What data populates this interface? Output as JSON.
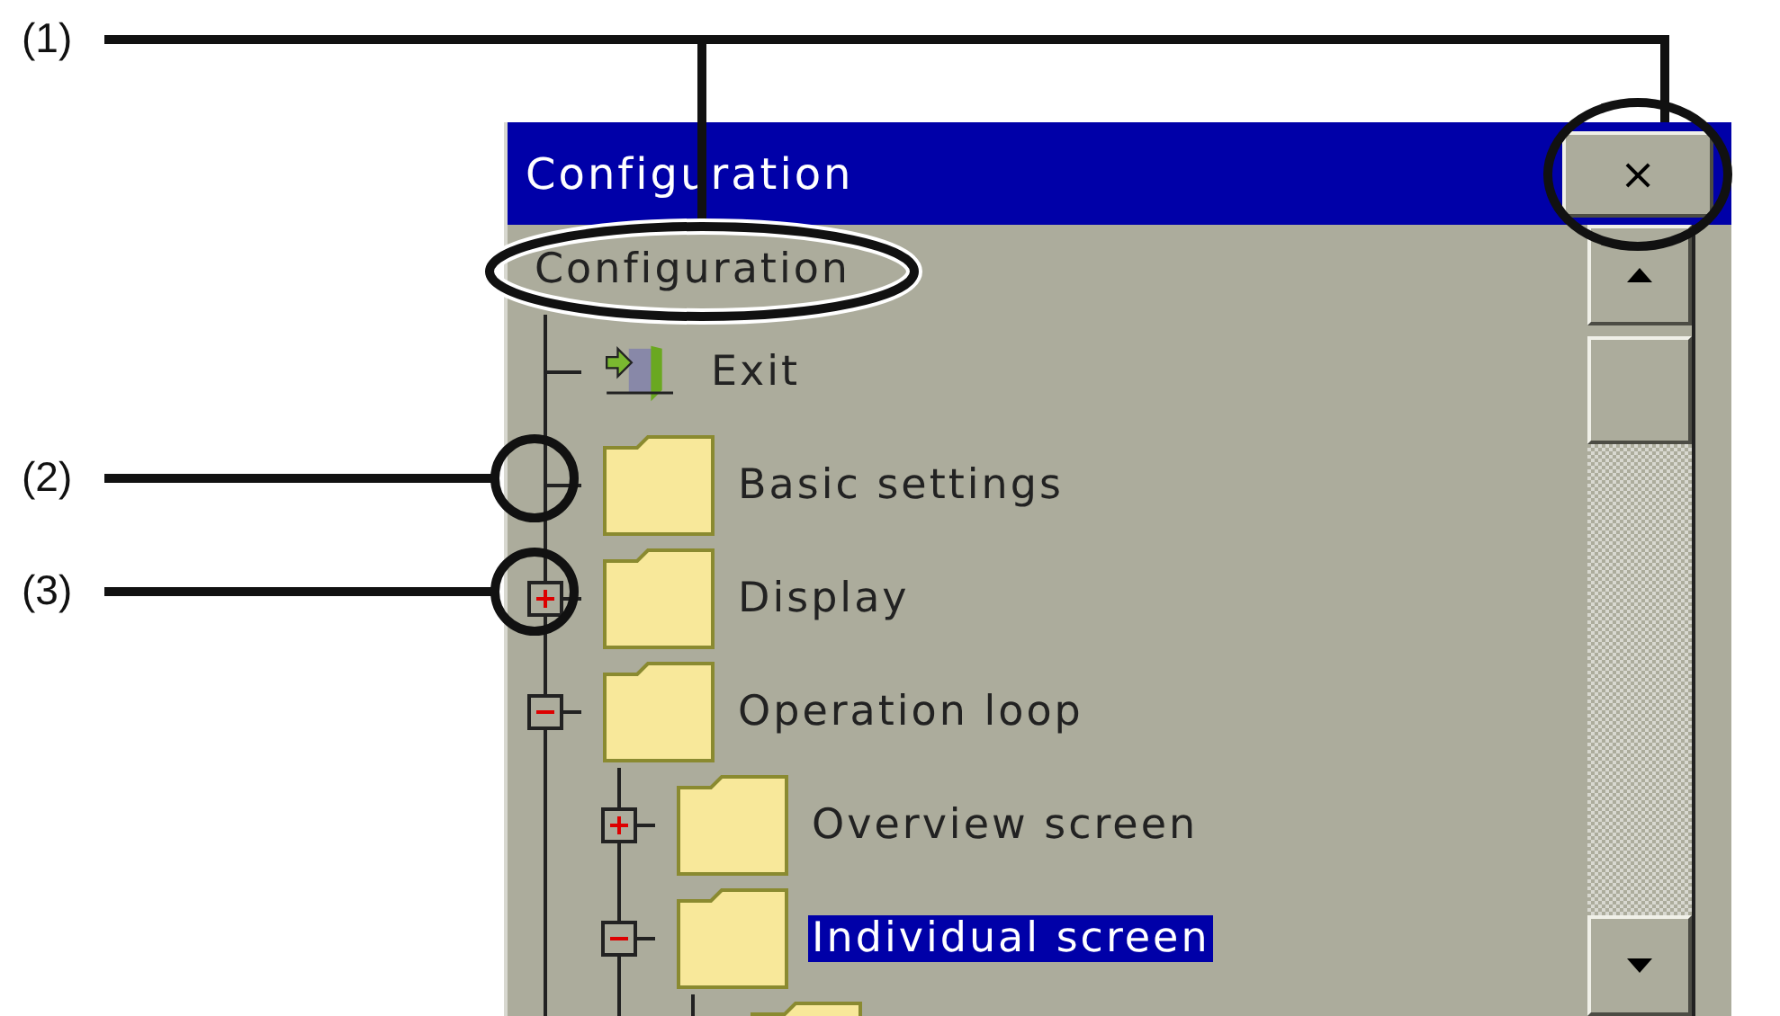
{
  "window": {
    "title": "Configuration",
    "close_label": "×"
  },
  "tree": {
    "root": "Configuration",
    "items": [
      {
        "kind": "exit",
        "label": "Exit"
      },
      {
        "kind": "folder",
        "label": "Basic settings"
      },
      {
        "kind": "folder",
        "label": "Display",
        "expanded": false
      },
      {
        "kind": "folder",
        "label": "Operation loop",
        "expanded": true,
        "children": [
          {
            "kind": "folder",
            "label": "Overview screen",
            "expanded": false,
            "selected": false
          },
          {
            "kind": "folder",
            "label": "Individual screen",
            "expanded": true,
            "selected": true,
            "children": [
              {
                "kind": "folder"
              }
            ]
          }
        ]
      }
    ]
  },
  "callouts": [
    {
      "label": "(1)"
    },
    {
      "label": "(2)"
    },
    {
      "label": "(3)"
    }
  ]
}
